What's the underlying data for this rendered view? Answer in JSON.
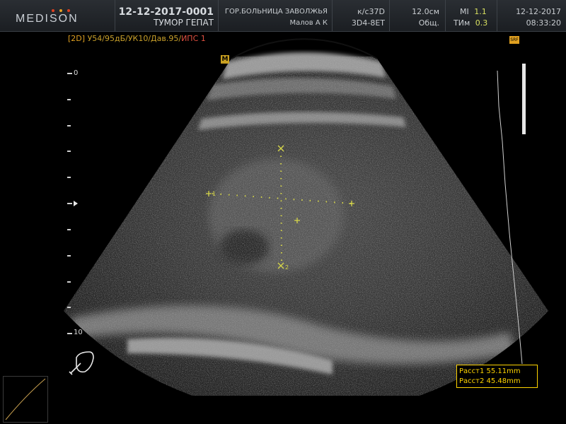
{
  "header": {
    "brand": "MEDISON",
    "brand_dot_colors": [
      "#e04020",
      "#e8a020",
      "#e04020"
    ],
    "patient_id": "12-12-2017-0001",
    "study": "ТУМОР ГЕПАТ",
    "hospital": "ГОР.БОЛЬНИЦА ЗАВОЛЖЬЯ",
    "operator": "Малов А К",
    "preset": "к/с37D",
    "probe": "3D4-8ET",
    "depth": "12.0см",
    "application": "Общ.",
    "mi_label": "MI",
    "mi_value": "1.1",
    "tim_label": "ТИм",
    "tim_value": "0.3",
    "date": "12-12-2017",
    "time": "08:33:20"
  },
  "image_params": {
    "mode": "[2D]",
    "settings": "У54/95дБ/УК10/Дав.95/",
    "ips": "ИПС 1"
  },
  "icons": {
    "marker_m": "M",
    "srf": "SRF"
  },
  "depth_scale": {
    "top_label": "0",
    "bottom_label": "10"
  },
  "calipers": {
    "label_1": "1",
    "label_2": "2"
  },
  "measurements": [
    {
      "label": "Расст1",
      "value": "55.11mm"
    },
    {
      "label": "Расст2",
      "value": "45.48mm"
    }
  ],
  "colors": {
    "caliper": "#d6d64a",
    "measurement": "#ffd400",
    "params": "#c8a02a",
    "header_bg": "#22262a"
  }
}
